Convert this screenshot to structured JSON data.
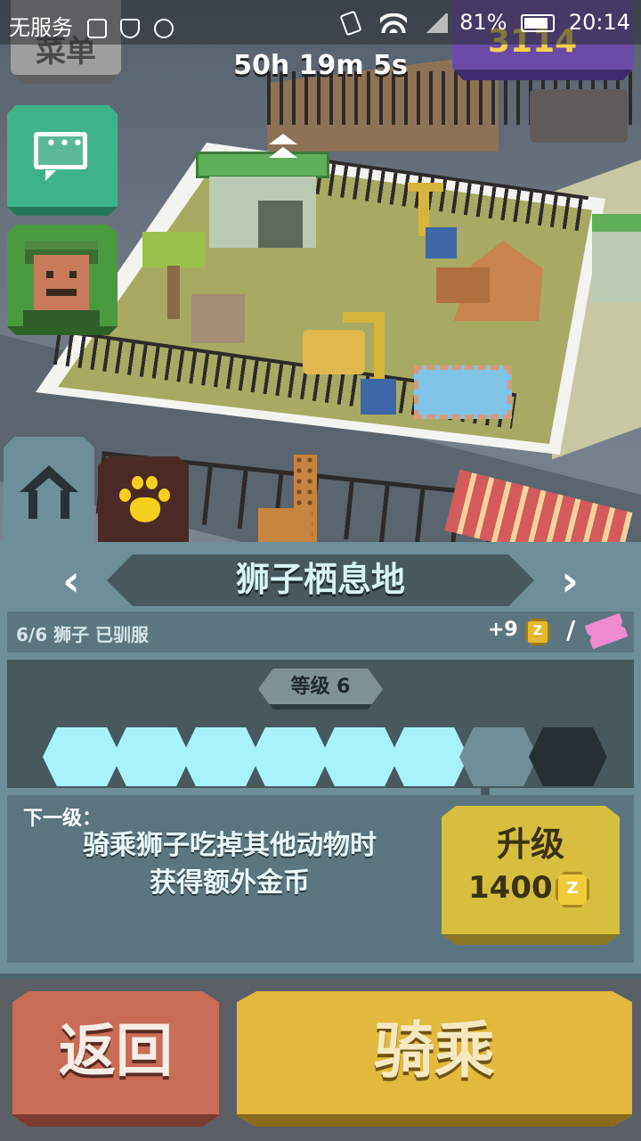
{
  "status_bar": {
    "carrier": "无服务",
    "battery_percent": "81%",
    "time": "20:14"
  },
  "hud": {
    "timer": "50h 19m 5s",
    "menu_button_label": "菜单",
    "coins_display": "3114"
  },
  "tabs": [
    {
      "name": "home",
      "icon": "home-icon",
      "selected": true
    },
    {
      "name": "animals",
      "icon": "paw-icon",
      "selected": false
    }
  ],
  "habitat": {
    "title": "狮子栖息地",
    "tamed_status": "6/6 狮子 已驯服",
    "bonus": "+9",
    "coin_symbol": "Z",
    "separator": "/",
    "level_label": "等级 6",
    "progress": {
      "filled": 6,
      "total": 8
    },
    "next_level_label": "下一级：",
    "next_level_desc": "骑乘狮子吃掉其他动物时获得额外金币",
    "next_level_desc_line1": "骑乘狮子吃掉其他动物时",
    "next_level_desc_line2": "获得额外金币",
    "upgrade_label": "升级",
    "upgrade_cost": "1400"
  },
  "actions": {
    "back_label": "返回",
    "ride_label": "骑乘"
  },
  "colors": {
    "panel": "#6e8f99",
    "progress_filled": "#a8f2fb",
    "upgrade": "#d8be3f",
    "back": "#c96c57",
    "ride": "#e2b83d",
    "paw_tab": "#4b2a26",
    "paw_icon": "#f5d01c"
  }
}
